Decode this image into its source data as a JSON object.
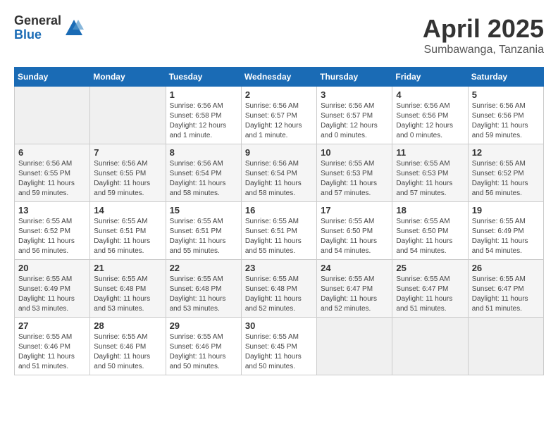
{
  "logo": {
    "general": "General",
    "blue": "Blue"
  },
  "title": "April 2025",
  "location": "Sumbawanga, Tanzania",
  "days_of_week": [
    "Sunday",
    "Monday",
    "Tuesday",
    "Wednesday",
    "Thursday",
    "Friday",
    "Saturday"
  ],
  "weeks": [
    [
      {
        "day": "",
        "sunrise": "",
        "sunset": "",
        "daylight": ""
      },
      {
        "day": "",
        "sunrise": "",
        "sunset": "",
        "daylight": ""
      },
      {
        "day": "1",
        "sunrise": "Sunrise: 6:56 AM",
        "sunset": "Sunset: 6:58 PM",
        "daylight": "Daylight: 12 hours and 1 minute."
      },
      {
        "day": "2",
        "sunrise": "Sunrise: 6:56 AM",
        "sunset": "Sunset: 6:57 PM",
        "daylight": "Daylight: 12 hours and 1 minute."
      },
      {
        "day": "3",
        "sunrise": "Sunrise: 6:56 AM",
        "sunset": "Sunset: 6:57 PM",
        "daylight": "Daylight: 12 hours and 0 minutes."
      },
      {
        "day": "4",
        "sunrise": "Sunrise: 6:56 AM",
        "sunset": "Sunset: 6:56 PM",
        "daylight": "Daylight: 12 hours and 0 minutes."
      },
      {
        "day": "5",
        "sunrise": "Sunrise: 6:56 AM",
        "sunset": "Sunset: 6:56 PM",
        "daylight": "Daylight: 11 hours and 59 minutes."
      }
    ],
    [
      {
        "day": "6",
        "sunrise": "Sunrise: 6:56 AM",
        "sunset": "Sunset: 6:55 PM",
        "daylight": "Daylight: 11 hours and 59 minutes."
      },
      {
        "day": "7",
        "sunrise": "Sunrise: 6:56 AM",
        "sunset": "Sunset: 6:55 PM",
        "daylight": "Daylight: 11 hours and 59 minutes."
      },
      {
        "day": "8",
        "sunrise": "Sunrise: 6:56 AM",
        "sunset": "Sunset: 6:54 PM",
        "daylight": "Daylight: 11 hours and 58 minutes."
      },
      {
        "day": "9",
        "sunrise": "Sunrise: 6:56 AM",
        "sunset": "Sunset: 6:54 PM",
        "daylight": "Daylight: 11 hours and 58 minutes."
      },
      {
        "day": "10",
        "sunrise": "Sunrise: 6:55 AM",
        "sunset": "Sunset: 6:53 PM",
        "daylight": "Daylight: 11 hours and 57 minutes."
      },
      {
        "day": "11",
        "sunrise": "Sunrise: 6:55 AM",
        "sunset": "Sunset: 6:53 PM",
        "daylight": "Daylight: 11 hours and 57 minutes."
      },
      {
        "day": "12",
        "sunrise": "Sunrise: 6:55 AM",
        "sunset": "Sunset: 6:52 PM",
        "daylight": "Daylight: 11 hours and 56 minutes."
      }
    ],
    [
      {
        "day": "13",
        "sunrise": "Sunrise: 6:55 AM",
        "sunset": "Sunset: 6:52 PM",
        "daylight": "Daylight: 11 hours and 56 minutes."
      },
      {
        "day": "14",
        "sunrise": "Sunrise: 6:55 AM",
        "sunset": "Sunset: 6:51 PM",
        "daylight": "Daylight: 11 hours and 56 minutes."
      },
      {
        "day": "15",
        "sunrise": "Sunrise: 6:55 AM",
        "sunset": "Sunset: 6:51 PM",
        "daylight": "Daylight: 11 hours and 55 minutes."
      },
      {
        "day": "16",
        "sunrise": "Sunrise: 6:55 AM",
        "sunset": "Sunset: 6:51 PM",
        "daylight": "Daylight: 11 hours and 55 minutes."
      },
      {
        "day": "17",
        "sunrise": "Sunrise: 6:55 AM",
        "sunset": "Sunset: 6:50 PM",
        "daylight": "Daylight: 11 hours and 54 minutes."
      },
      {
        "day": "18",
        "sunrise": "Sunrise: 6:55 AM",
        "sunset": "Sunset: 6:50 PM",
        "daylight": "Daylight: 11 hours and 54 minutes."
      },
      {
        "day": "19",
        "sunrise": "Sunrise: 6:55 AM",
        "sunset": "Sunset: 6:49 PM",
        "daylight": "Daylight: 11 hours and 54 minutes."
      }
    ],
    [
      {
        "day": "20",
        "sunrise": "Sunrise: 6:55 AM",
        "sunset": "Sunset: 6:49 PM",
        "daylight": "Daylight: 11 hours and 53 minutes."
      },
      {
        "day": "21",
        "sunrise": "Sunrise: 6:55 AM",
        "sunset": "Sunset: 6:48 PM",
        "daylight": "Daylight: 11 hours and 53 minutes."
      },
      {
        "day": "22",
        "sunrise": "Sunrise: 6:55 AM",
        "sunset": "Sunset: 6:48 PM",
        "daylight": "Daylight: 11 hours and 53 minutes."
      },
      {
        "day": "23",
        "sunrise": "Sunrise: 6:55 AM",
        "sunset": "Sunset: 6:48 PM",
        "daylight": "Daylight: 11 hours and 52 minutes."
      },
      {
        "day": "24",
        "sunrise": "Sunrise: 6:55 AM",
        "sunset": "Sunset: 6:47 PM",
        "daylight": "Daylight: 11 hours and 52 minutes."
      },
      {
        "day": "25",
        "sunrise": "Sunrise: 6:55 AM",
        "sunset": "Sunset: 6:47 PM",
        "daylight": "Daylight: 11 hours and 51 minutes."
      },
      {
        "day": "26",
        "sunrise": "Sunrise: 6:55 AM",
        "sunset": "Sunset: 6:47 PM",
        "daylight": "Daylight: 11 hours and 51 minutes."
      }
    ],
    [
      {
        "day": "27",
        "sunrise": "Sunrise: 6:55 AM",
        "sunset": "Sunset: 6:46 PM",
        "daylight": "Daylight: 11 hours and 51 minutes."
      },
      {
        "day": "28",
        "sunrise": "Sunrise: 6:55 AM",
        "sunset": "Sunset: 6:46 PM",
        "daylight": "Daylight: 11 hours and 50 minutes."
      },
      {
        "day": "29",
        "sunrise": "Sunrise: 6:55 AM",
        "sunset": "Sunset: 6:46 PM",
        "daylight": "Daylight: 11 hours and 50 minutes."
      },
      {
        "day": "30",
        "sunrise": "Sunrise: 6:55 AM",
        "sunset": "Sunset: 6:45 PM",
        "daylight": "Daylight: 11 hours and 50 minutes."
      },
      {
        "day": "",
        "sunrise": "",
        "sunset": "",
        "daylight": ""
      },
      {
        "day": "",
        "sunrise": "",
        "sunset": "",
        "daylight": ""
      },
      {
        "day": "",
        "sunrise": "",
        "sunset": "",
        "daylight": ""
      }
    ]
  ]
}
